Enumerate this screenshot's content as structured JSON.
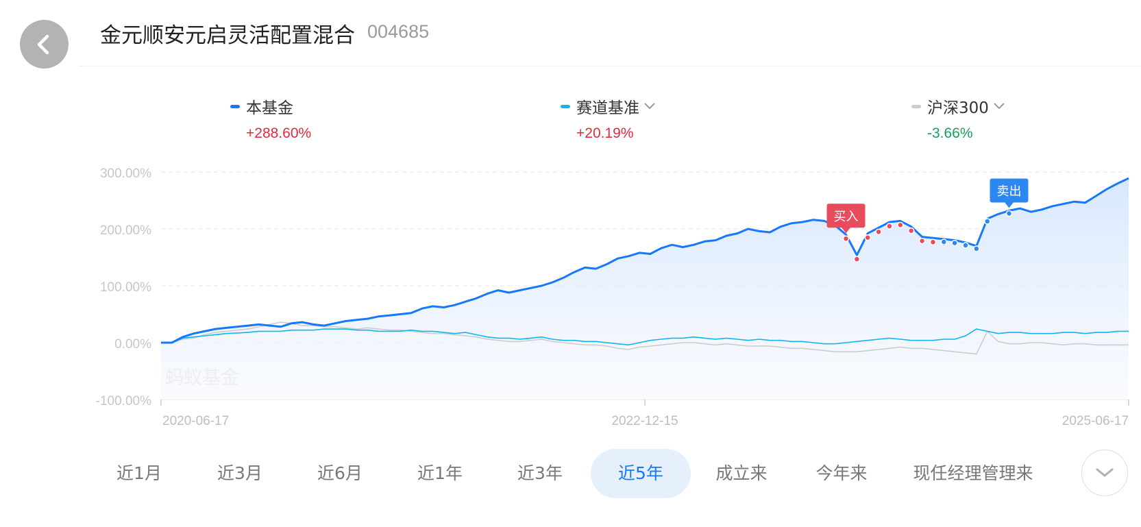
{
  "header": {
    "title": "金元顺安元启灵活配置混合",
    "code": "004685"
  },
  "legend": [
    {
      "label": "本基金",
      "value": "+288.60%",
      "color": "#1677ff",
      "value_color": "#e5283c",
      "has_dropdown": false
    },
    {
      "label": "赛道基准",
      "value": "+20.19%",
      "color": "#0fb4f0",
      "value_color": "#e5283c",
      "has_dropdown": true
    },
    {
      "label": "沪深300",
      "value": "-3.66%",
      "color": "#cccccc",
      "value_color": "#17a05d",
      "has_dropdown": true
    }
  ],
  "watermark": "蚂蚁基金",
  "markers": {
    "buy_label": "买入",
    "sell_label": "卖出",
    "buy_color": "#e84b5c",
    "sell_color": "#2d87f0"
  },
  "ranges": [
    "近1月",
    "近3月",
    "近6月",
    "近1年",
    "近3年",
    "近5年",
    "成立来",
    "今年来",
    "现任经理管理来"
  ],
  "active_range": "近5年",
  "chart_data": {
    "type": "line",
    "x_labels": [
      "2020-06-17",
      "2022-12-15",
      "2025-06-17"
    ],
    "y_ticks": [
      "300.00%",
      "200.00%",
      "100.00%",
      "0.00%",
      "-100.00%"
    ],
    "ylim": [
      -100,
      300
    ],
    "grid": true,
    "series": [
      {
        "name": "本基金",
        "color": "#1677ff",
        "fill": true,
        "values": [
          0,
          0,
          10,
          16,
          20,
          24,
          26,
          28,
          30,
          32,
          30,
          28,
          34,
          36,
          32,
          30,
          34,
          38,
          40,
          42,
          46,
          48,
          50,
          52,
          60,
          64,
          62,
          66,
          72,
          78,
          86,
          92,
          88,
          92,
          96,
          100,
          106,
          114,
          124,
          132,
          130,
          138,
          148,
          152,
          158,
          156,
          166,
          172,
          168,
          172,
          178,
          180,
          188,
          192,
          200,
          196,
          194,
          204,
          210,
          212,
          216,
          214,
          206,
          190,
          154,
          192,
          202,
          212,
          214,
          204,
          186,
          184,
          182,
          180,
          176,
          170,
          218,
          226,
          232,
          236,
          230,
          234,
          240,
          244,
          248,
          246,
          258,
          270,
          280,
          289
        ]
      },
      {
        "name": "赛道基准",
        "color": "#0fb4f0",
        "fill": false,
        "values": [
          0,
          0,
          8,
          10,
          12,
          14,
          16,
          17,
          18,
          20,
          20,
          20,
          22,
          22,
          22,
          24,
          24,
          24,
          22,
          22,
          20,
          20,
          20,
          22,
          20,
          20,
          18,
          16,
          18,
          14,
          10,
          8,
          8,
          6,
          8,
          10,
          6,
          4,
          4,
          2,
          2,
          0,
          -2,
          -4,
          0,
          4,
          6,
          8,
          8,
          10,
          8,
          6,
          8,
          6,
          4,
          6,
          4,
          4,
          2,
          2,
          0,
          -2,
          -2,
          0,
          2,
          4,
          6,
          8,
          6,
          4,
          4,
          4,
          6,
          6,
          12,
          24,
          20,
          16,
          18,
          18,
          16,
          16,
          16,
          18,
          18,
          16,
          18,
          18,
          20,
          20
        ]
      },
      {
        "name": "沪深300",
        "color": "#cccccc",
        "fill": false,
        "values": [
          0,
          0,
          6,
          8,
          14,
          18,
          20,
          22,
          24,
          28,
          32,
          36,
          34,
          30,
          30,
          28,
          28,
          26,
          24,
          26,
          24,
          22,
          22,
          20,
          18,
          16,
          16,
          14,
          12,
          10,
          6,
          4,
          2,
          2,
          4,
          6,
          2,
          0,
          -2,
          -4,
          -4,
          -6,
          -10,
          -12,
          -8,
          -6,
          -4,
          -2,
          0,
          0,
          -2,
          -4,
          -2,
          -4,
          -6,
          -6,
          -6,
          -8,
          -10,
          -10,
          -12,
          -14,
          -16,
          -16,
          -16,
          -14,
          -12,
          -10,
          -8,
          -10,
          -10,
          -12,
          -14,
          -16,
          -18,
          -20,
          20,
          2,
          -2,
          -2,
          0,
          0,
          -2,
          -4,
          -2,
          -2,
          -4,
          -4,
          -4,
          -4
        ]
      }
    ],
    "buy_points": [
      63,
      64,
      65,
      66,
      67,
      68,
      69,
      70,
      71,
      72
    ],
    "sell_points": [
      72,
      73,
      74,
      75,
      76,
      78
    ]
  }
}
